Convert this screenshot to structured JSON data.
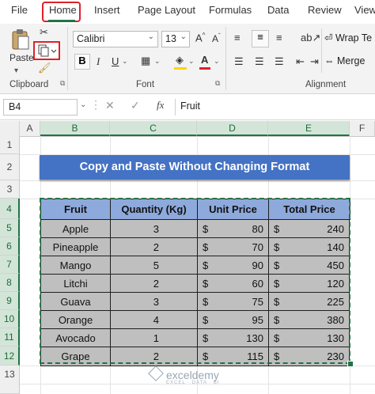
{
  "ribbon": {
    "tabs": [
      "File",
      "Home",
      "Insert",
      "Page Layout",
      "Formulas",
      "Data",
      "Review",
      "View"
    ],
    "paste_label": "Paste",
    "font_name": "Calibri",
    "font_size": "13",
    "bold": "B",
    "italic": "I",
    "underline": "U",
    "wrap_text": "Wrap Te",
    "merge": "Merge",
    "groups": {
      "clipboard": "Clipboard",
      "font": "Font",
      "alignment": "Alignment"
    }
  },
  "formula_bar": {
    "name_box": "B4",
    "fx": "fx",
    "content": "Fruit"
  },
  "grid": {
    "columns": [
      "A",
      "B",
      "C",
      "D",
      "E",
      "F"
    ],
    "rows": [
      "1",
      "2",
      "3",
      "4",
      "5",
      "6",
      "7",
      "8",
      "9",
      "10",
      "11",
      "12",
      "13"
    ],
    "selected_cell": "B4"
  },
  "sheet": {
    "title": "Copy and Paste Without Changing Format",
    "headers": [
      "Fruit",
      "Quantity (Kg)",
      "Unit Price",
      "Total Price"
    ],
    "currency": "$",
    "rows": [
      {
        "fruit": "Apple",
        "qty": "3",
        "unit": "80",
        "total": "240"
      },
      {
        "fruit": "Pineapple",
        "qty": "2",
        "unit": "70",
        "total": "140"
      },
      {
        "fruit": "Mango",
        "qty": "5",
        "unit": "90",
        "total": "450"
      },
      {
        "fruit": "Litchi",
        "qty": "2",
        "unit": "60",
        "total": "120"
      },
      {
        "fruit": "Guava",
        "qty": "3",
        "unit": "75",
        "total": "225"
      },
      {
        "fruit": "Orange",
        "qty": "4",
        "unit": "95",
        "total": "380"
      },
      {
        "fruit": "Avocado",
        "qty": "1",
        "unit": "130",
        "total": "130"
      },
      {
        "fruit": "Grape",
        "qty": "2",
        "unit": "115",
        "total": "230"
      }
    ]
  },
  "watermark": {
    "brand": "exceldemy",
    "tagline": "EXCEL · DATA · BI"
  }
}
